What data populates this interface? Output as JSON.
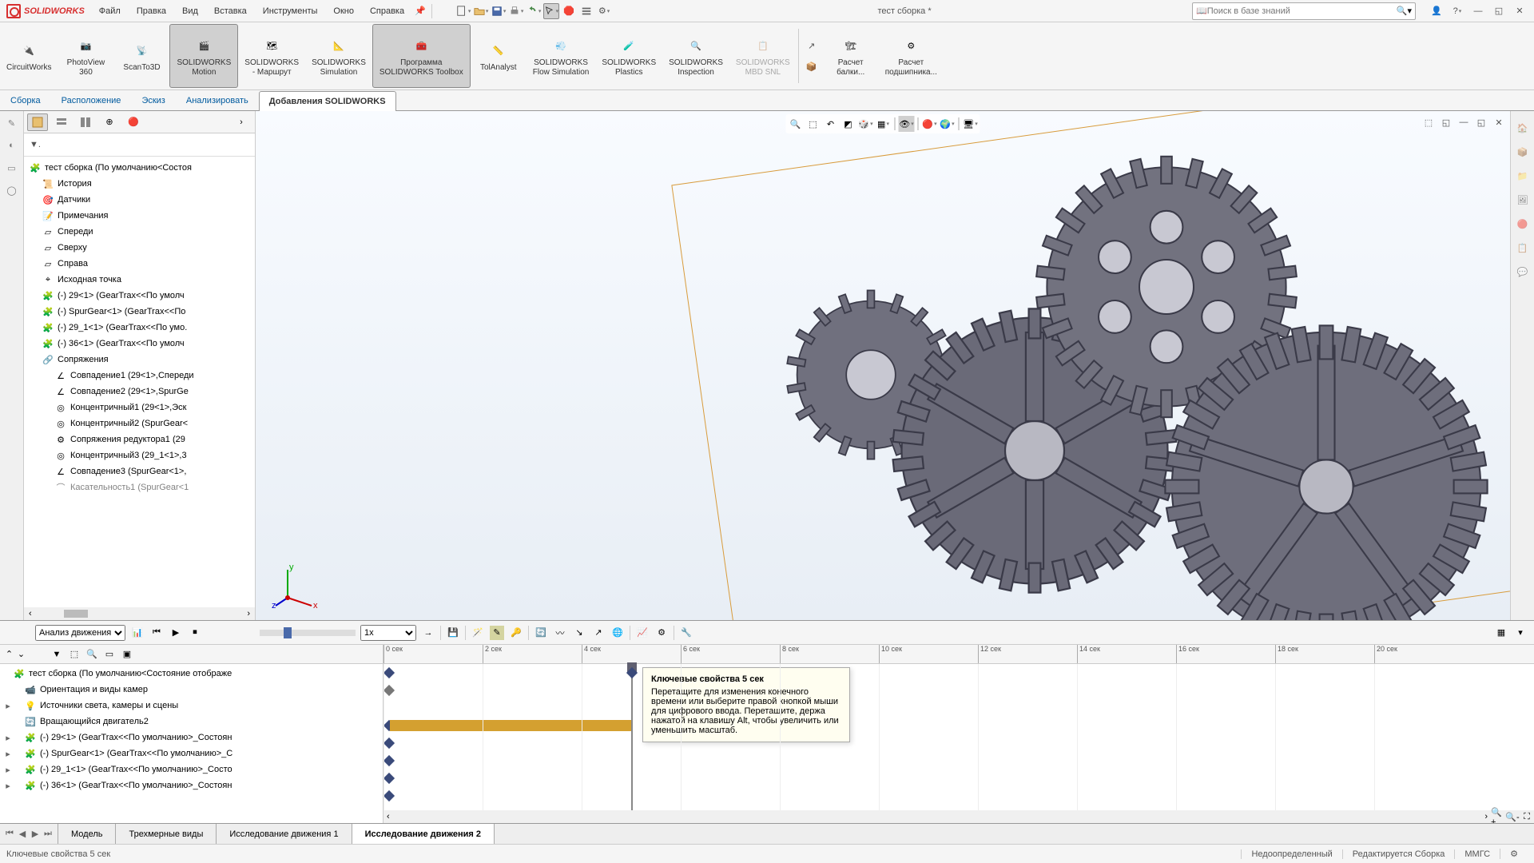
{
  "app": {
    "logo": "SOLIDWORKS",
    "title": "тест сборка *"
  },
  "menu": [
    "Файл",
    "Правка",
    "Вид",
    "Вставка",
    "Инструменты",
    "Окно",
    "Справка"
  ],
  "search": {
    "placeholder": "Поиск в базе знаний"
  },
  "ribbon": [
    {
      "label": "CircuitWorks"
    },
    {
      "label": "PhotoView\n360"
    },
    {
      "label": "ScanTo3D"
    },
    {
      "label": "SOLIDWORKS\nMotion",
      "active": true
    },
    {
      "label": "SOLIDWORKS\n- Маршрут"
    },
    {
      "label": "SOLIDWORKS\nSimulation"
    },
    {
      "label": "Программа\nSOLIDWORKS Toolbox",
      "active": true
    },
    {
      "label": "TolAnalyst"
    },
    {
      "label": "SOLIDWORKS\nFlow Simulation"
    },
    {
      "label": "SOLIDWORKS\nPlastics"
    },
    {
      "label": "SOLIDWORKS\nInspection"
    },
    {
      "label": "SOLIDWORKS\nMBD SNL",
      "disabled": true
    },
    {
      "label": "Расчет\nбалки..."
    },
    {
      "label": "Расчет\nподшипника..."
    }
  ],
  "tabs": [
    "Сборка",
    "Расположение",
    "Эскиз",
    "Анализировать",
    "Добавления SOLIDWORKS"
  ],
  "active_tab": 4,
  "tree": {
    "root": "тест сборка  (По умолчанию<Состоя",
    "items": [
      {
        "icon": "history",
        "label": "История",
        "indent": 1
      },
      {
        "icon": "sensor",
        "label": "Датчики",
        "indent": 1
      },
      {
        "icon": "note",
        "label": "Примечания",
        "indent": 1
      },
      {
        "icon": "plane",
        "label": "Спереди",
        "indent": 1
      },
      {
        "icon": "plane",
        "label": "Сверху",
        "indent": 1
      },
      {
        "icon": "plane",
        "label": "Справа",
        "indent": 1
      },
      {
        "icon": "origin",
        "label": "Исходная точка",
        "indent": 1
      },
      {
        "icon": "part",
        "label": "(-) 29<1> (GearTrax<<По умолч",
        "indent": 1
      },
      {
        "icon": "part",
        "label": "(-) SpurGear<1> (GearTrax<<По",
        "indent": 1
      },
      {
        "icon": "part",
        "label": "(-) 29_1<1> (GearTrax<<По умо.",
        "indent": 1
      },
      {
        "icon": "part",
        "label": "(-) 36<1> (GearTrax<<По умолч",
        "indent": 1
      },
      {
        "icon": "mate",
        "label": "Сопряжения",
        "indent": 1
      },
      {
        "icon": "coincident",
        "label": "Совпадение1 (29<1>,Спереди",
        "indent": 2
      },
      {
        "icon": "coincident",
        "label": "Совпадение2 (29<1>,SpurGe",
        "indent": 2
      },
      {
        "icon": "concentric",
        "label": "Концентричный1 (29<1>,Эск",
        "indent": 2
      },
      {
        "icon": "concentric",
        "label": "Концентричный2 (SpurGear<",
        "indent": 2
      },
      {
        "icon": "gearmate",
        "label": "Сопряжения редуктора1 (29",
        "indent": 2
      },
      {
        "icon": "concentric",
        "label": "Концентричный3 (29_1<1>,3",
        "indent": 2
      },
      {
        "icon": "coincident",
        "label": "Совпадение3 (SpurGear<1>,",
        "indent": 2
      },
      {
        "icon": "tangent",
        "label": "Касательность1 (SpurGear<1",
        "indent": 2,
        "dim": true
      }
    ]
  },
  "motion": {
    "study_type": "Анализ движения",
    "tree_root": "тест сборка  (По умолчанию<Состояние отображе",
    "tree": [
      {
        "label": "Ориентация и виды камер",
        "indent": 1,
        "icon": "camera"
      },
      {
        "label": "Источники света, камеры и сцены",
        "indent": 1,
        "icon": "light",
        "exp": true
      },
      {
        "label": "Вращающийся двигатель2",
        "indent": 1,
        "icon": "motor"
      },
      {
        "label": "(-) 29<1> (GearTrax<<По умолчанию>_Состоян",
        "indent": 1,
        "icon": "part",
        "exp": true
      },
      {
        "label": "(-) SpurGear<1> (GearTrax<<По умолчанию>_С",
        "indent": 1,
        "icon": "part",
        "exp": true
      },
      {
        "label": "(-) 29_1<1> (GearTrax<<По умолчанию>_Состо",
        "indent": 1,
        "icon": "part",
        "exp": true
      },
      {
        "label": "(-) 36<1> (GearTrax<<По умолчанию>_Состоян",
        "indent": 1,
        "icon": "part",
        "exp": true
      }
    ],
    "ticks": [
      "0 сек",
      "2 сек",
      "4 сек",
      "6 сек",
      "8 сек",
      "10 сек",
      "12 сек",
      "14 сек",
      "16 сек",
      "18 сек",
      "20 сек"
    ],
    "cursor_at": 5,
    "tooltip": {
      "title": "Ключевые свойства 5 сек",
      "body": "Перетащите для изменения конечного времени или выберите правой кнопкой мыши для цифрового ввода. Перетащите, держа нажатой на клавишу Alt, чтобы увеличить или уменьшить масштаб."
    }
  },
  "bottom_tabs": [
    "Модель",
    "Трехмерные виды",
    "Исследование движения 1",
    "Исследование движения 2"
  ],
  "bottom_active": 3,
  "status": {
    "left": "Ключевые свойства 5 сек",
    "defined": "Недоопределенный",
    "editing": "Редактируется Сборка",
    "units": "ММГС"
  }
}
